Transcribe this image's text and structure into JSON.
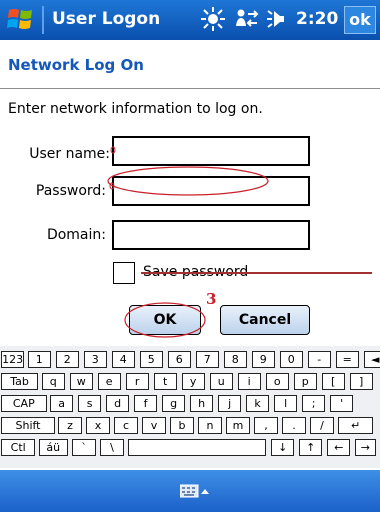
{
  "title_bar": {
    "app_title": "User Logon",
    "time": "2:20",
    "ok_label": "ok",
    "icons": [
      "windows-start-icon",
      "sun-icon",
      "connectivity-icon",
      "volume-icon"
    ]
  },
  "header": {
    "title": "Network Log On"
  },
  "form": {
    "instruction": "Enter network information to log on.",
    "username_label": "User name:",
    "password_label": "Password:",
    "domain_label": "Domain:",
    "save_password_label": "Save password",
    "save_password_checked": false,
    "ok_button": "OK",
    "cancel_button": "Cancel"
  },
  "annotation": {
    "step_number": "3",
    "color": "#c8202a"
  },
  "keyboard": {
    "rows": [
      [
        "123",
        "1",
        "2",
        "3",
        "4",
        "5",
        "6",
        "7",
        "8",
        "9",
        "0",
        "-",
        "=",
        "◄"
      ],
      [
        "Tab",
        "q",
        "w",
        "e",
        "r",
        "t",
        "y",
        "u",
        "i",
        "o",
        "p",
        "[",
        "]"
      ],
      [
        "CAP",
        "a",
        "s",
        "d",
        "f",
        "g",
        "h",
        "j",
        "k",
        "l",
        ";",
        "'"
      ],
      [
        "Shift",
        "z",
        "x",
        "c",
        "v",
        "b",
        "n",
        "m",
        ",",
        ".",
        "/",
        "↵"
      ],
      [
        "Ctl",
        "áü",
        "`",
        "\\",
        "",
        "↓",
        "↑",
        "←",
        "→"
      ]
    ]
  },
  "colors": {
    "title_bar": "#0a4fae",
    "header_text": "#1458b9",
    "bottom_bar": "#1b61c9"
  },
  "bottom_bar": {
    "sip_icon": "keyboard-icon"
  }
}
